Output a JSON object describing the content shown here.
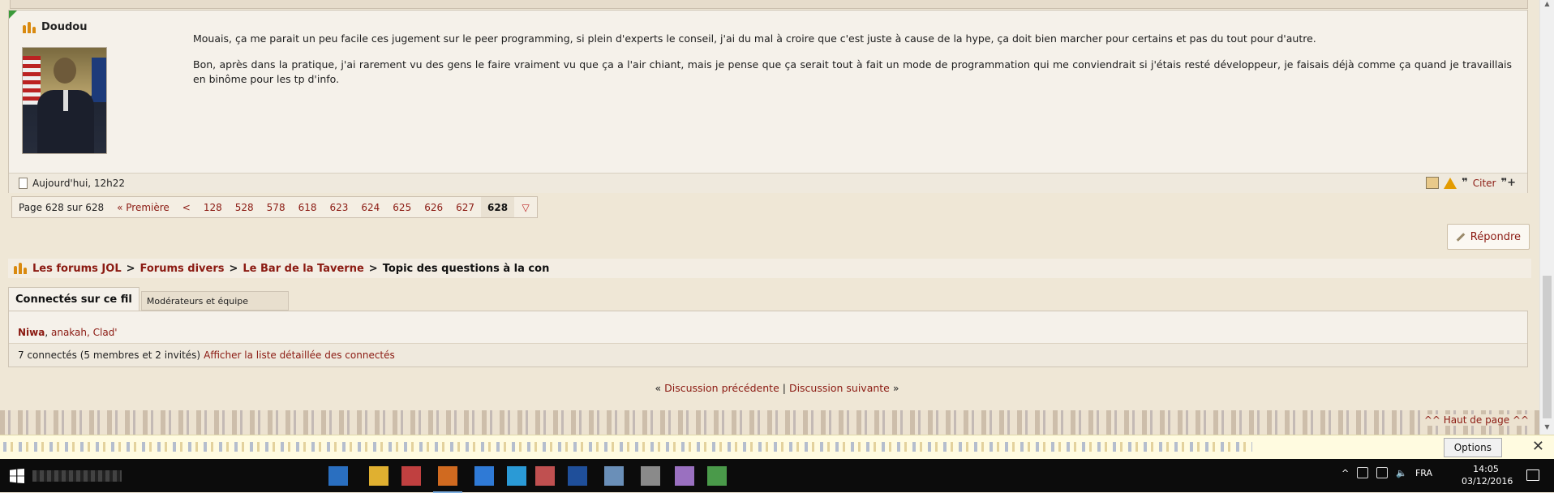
{
  "post": {
    "author": "Doudou",
    "paragraphs": [
      "Mouais, ça me parait un peu facile ces jugement sur le peer programming, si plein d'experts le conseil, j'ai du mal à croire que c'est juste à cause de la hype, ça doit bien marcher pour certains et pas du tout pour d'autre.",
      "Bon, après dans la pratique, j'ai rarement vu des gens le faire vraiment vu que ça a l'air chiant, mais je pense que ça serait tout à fait un mode de programmation qui me conviendrait si j'étais resté développeur, je faisais déjà comme ça quand je travaillais en binôme pour les tp d'info."
    ],
    "date": "Aujourd'hui, 12h22",
    "cite_label": "Citer"
  },
  "pager": {
    "label": "Page 628 sur 628",
    "first": "« Première",
    "prev": "<",
    "pages": [
      "128",
      "528",
      "578",
      "618",
      "623",
      "624",
      "625",
      "626",
      "627"
    ],
    "current": "628"
  },
  "reply_label": "Répondre",
  "breadcrumb": {
    "items": [
      "Les forums JOL",
      "Forums divers",
      "Le Bar de la Taverne"
    ],
    "current": "Topic des questions à la con"
  },
  "connected": {
    "tab_active": "Connectés sur ce fil",
    "tab_other": "Modérateurs et équipe",
    "moderator": "Niwa",
    "members": "anakah, Clad'",
    "count_text": "7 connectés (5 membres et 2 invités)",
    "detail_link": "Afficher la liste détaillée des connectés"
  },
  "discussion": {
    "prev": "Discussion précédente",
    "next": "Discussion suivante"
  },
  "top_link": "^^ Haut de page ^^",
  "notification": {
    "options_label": "Options"
  },
  "taskbar": {
    "language": "FRA",
    "time": "14:05",
    "date": "03/12/2016"
  },
  "colors": {
    "link": "#8b1a12",
    "background": "#efe7d6",
    "panel": "#f5f1ea",
    "taskbar": "#0c0c0c"
  }
}
